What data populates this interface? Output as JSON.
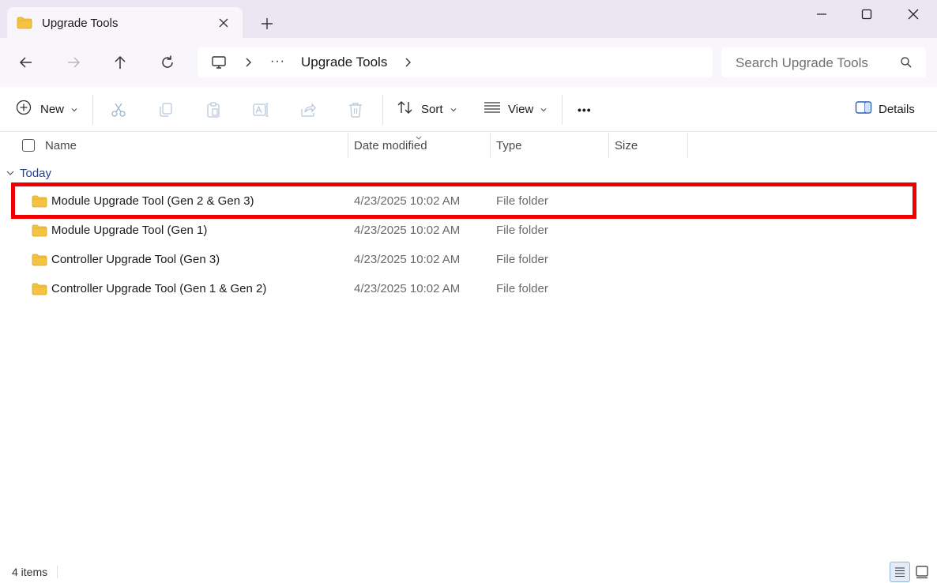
{
  "window": {
    "tab_title": "Upgrade Tools",
    "tab_icon": "folder-icon",
    "new_tab_icon": "plus-icon",
    "controls": [
      "minimize-icon",
      "maximize-icon",
      "close-icon"
    ]
  },
  "nav": {
    "back_icon": "arrow-left-icon",
    "forward_icon": "arrow-right-icon",
    "up_icon": "arrow-up-icon",
    "refresh_icon": "refresh-icon",
    "address": {
      "root_icon": "monitor-icon",
      "overflow": "···",
      "crumb": "Upgrade Tools"
    },
    "search_placeholder": "Search Upgrade Tools"
  },
  "toolbar": {
    "new_label": "New",
    "sort_label": "Sort",
    "view_label": "View",
    "more_label": "•••",
    "details_label": "Details",
    "action_icons": [
      "cut-icon",
      "copy-icon",
      "paste-icon",
      "rename-icon",
      "share-icon",
      "delete-icon"
    ]
  },
  "columns": {
    "name": "Name",
    "date": "Date modified",
    "type": "Type",
    "size": "Size"
  },
  "group": {
    "label": "Today"
  },
  "files": [
    {
      "name": "Module Upgrade Tool (Gen 2 & Gen 3)",
      "date": "4/23/2025 10:02 AM",
      "type": "File folder"
    },
    {
      "name": "Module Upgrade Tool (Gen 1)",
      "date": "4/23/2025 10:02 AM",
      "type": "File folder"
    },
    {
      "name": "Controller Upgrade Tool (Gen 3)",
      "date": "4/23/2025 10:02 AM",
      "type": "File folder"
    },
    {
      "name": "Controller Upgrade Tool (Gen 1 & Gen 2)",
      "date": "4/23/2025 10:02 AM",
      "type": "File folder"
    }
  ],
  "status": {
    "count": "4 items"
  },
  "colors": {
    "highlight": "#ee0000",
    "folder": "#f5c342",
    "titlebar": "#eae6f2",
    "navbar": "#f8f6fb"
  }
}
